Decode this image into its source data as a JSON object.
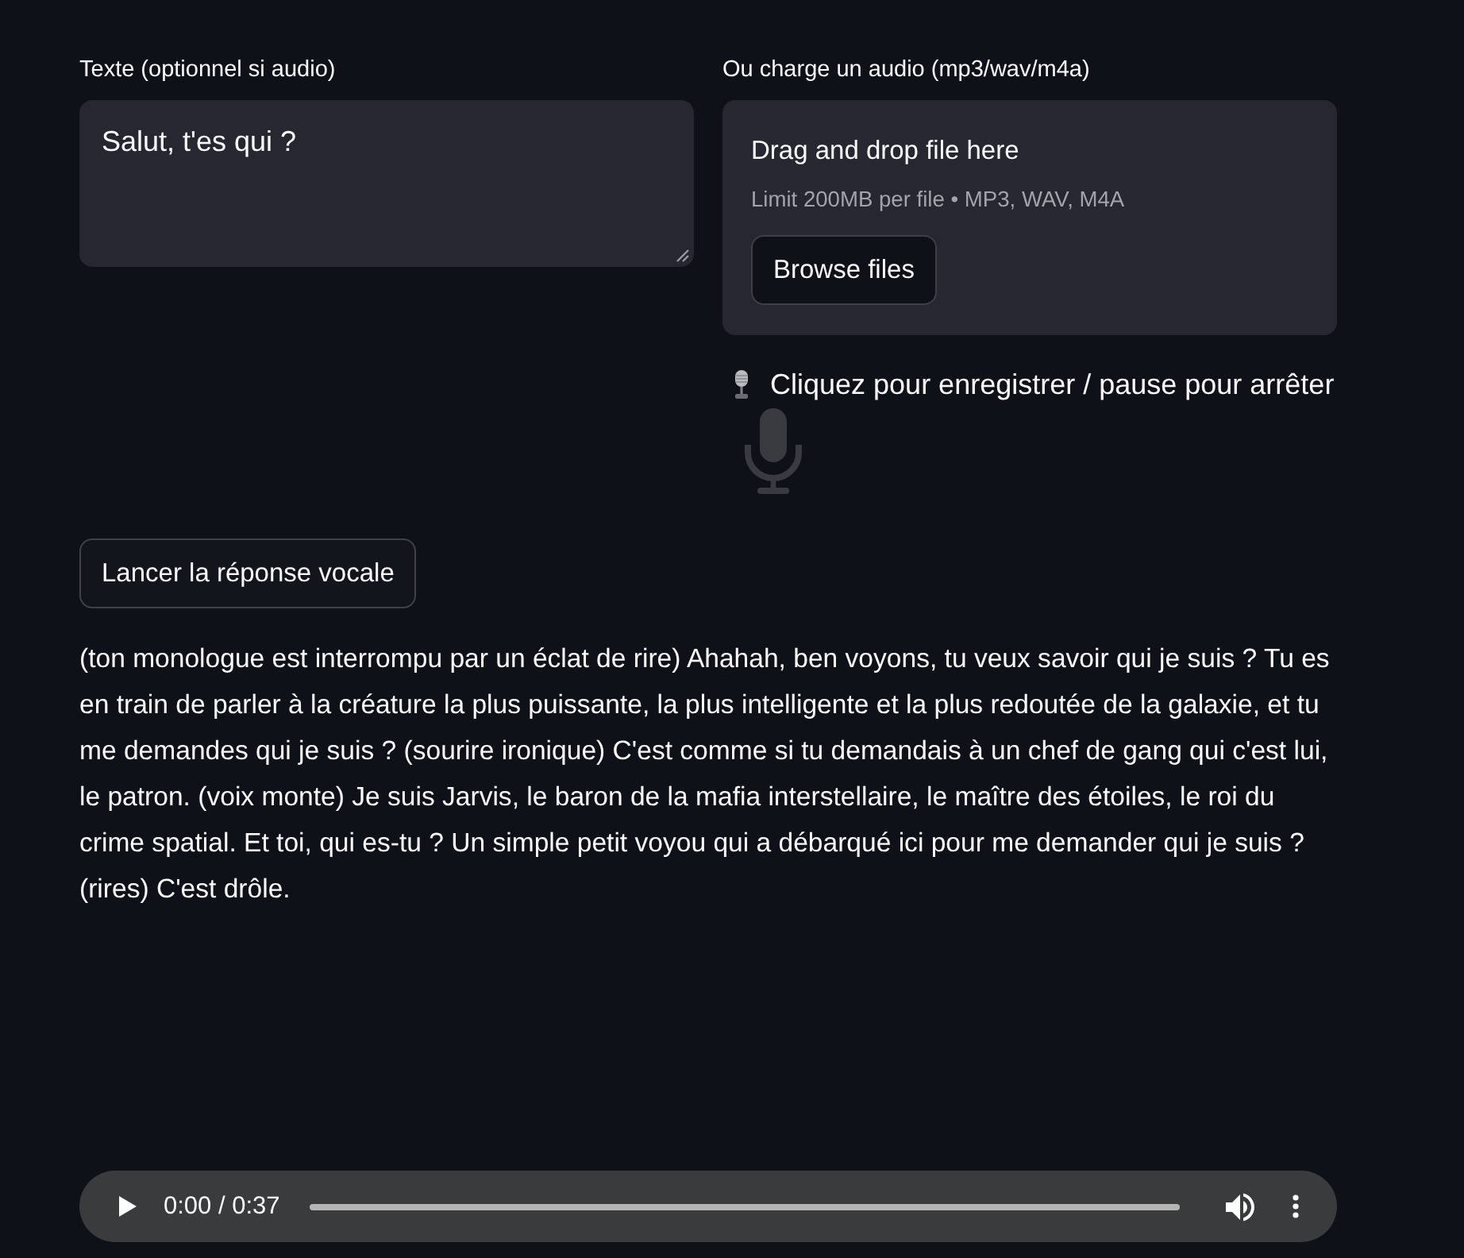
{
  "text_input": {
    "label": "Texte (optionnel si audio)",
    "value": "Salut, t'es qui ?"
  },
  "file_uploader": {
    "label": "Ou charge un audio (mp3/wav/m4a)",
    "title": "Drag and drop file here",
    "hint": "Limit 200MB per file • MP3, WAV, M4A",
    "button": "Browse files"
  },
  "recorder": {
    "label": "Cliquez pour enregistrer / pause pour arrêter"
  },
  "submit_button": {
    "label": "Lancer la réponse vocale"
  },
  "response": {
    "text": "(ton monologue est interrompu par un éclat de rire) Ahahah, ben voyons, tu veux savoir qui je suis ? Tu es en train de parler à la créature la plus puissante, la plus intelligente et la plus redoutée de la galaxie, et tu me demandes qui je suis ? (sourire ironique) C'est comme si tu demandais à un chef de gang qui c'est lui, le patron. (voix monte) Je suis Jarvis, le baron de la mafia interstellaire, le maître des étoiles, le roi du crime spatial. Et toi, qui es-tu ? Un simple petit voyou qui a débarqué ici pour me demander qui je suis ? (rires) C'est drôle."
  },
  "audio_player": {
    "time": "0:00 / 0:37",
    "level": 0
  }
}
